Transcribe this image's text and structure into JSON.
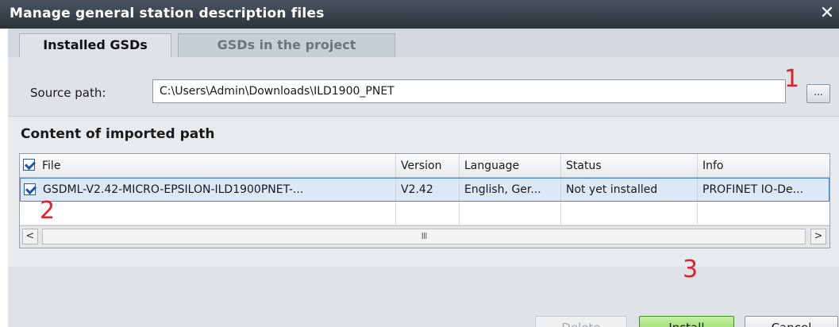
{
  "window": {
    "title": "Manage general station description files",
    "close_glyph": "✕"
  },
  "tabs": [
    {
      "label": "Installed GSDs",
      "active": true
    },
    {
      "label": "GSDs in the project",
      "active": false
    }
  ],
  "source": {
    "label": "Source path:",
    "value": "C:\\Users\\Admin\\Downloads\\ILD1900_PNET",
    "browse_label": "..."
  },
  "content": {
    "title": "Content of imported path",
    "columns": [
      "File",
      "Version",
      "Language",
      "Status",
      "Info"
    ],
    "rows": [
      {
        "checked": true,
        "file": "GSDML-V2.42-MICRO-EPSILON-ILD1900PNET-...",
        "version": "V2.42",
        "language": "English, Ger...",
        "status": "Not yet installed",
        "info": "PROFINET IO-De..."
      }
    ],
    "scrollbar": {
      "left_arrow": "<",
      "thumb_grip": "III",
      "right_arrow": ">"
    }
  },
  "annotations": [
    "1",
    "2",
    "3"
  ],
  "buttons": {
    "delete": "Delete",
    "install": "Install",
    "cancel": "Cancel"
  },
  "colors": {
    "title_bar": "#2b333b",
    "install_green": "#7fd04a",
    "annotation_red": "#e0202e",
    "selection": "#dce8f5"
  }
}
